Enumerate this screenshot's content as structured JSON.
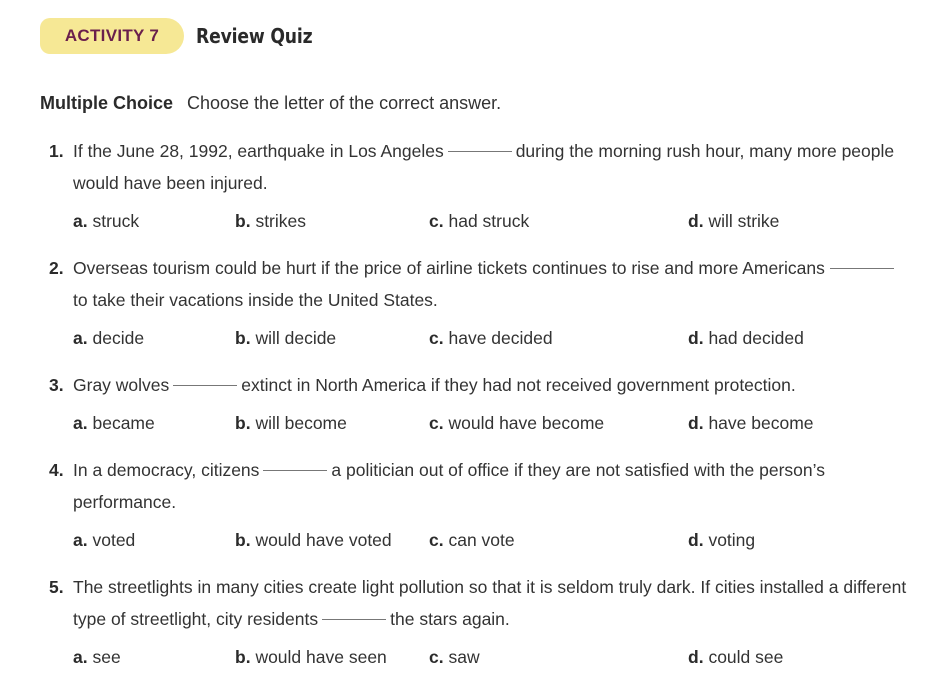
{
  "header": {
    "activity_label": "ACTIVITY 7",
    "title": "Review Quiz"
  },
  "instructions": {
    "heading": "Multiple Choice",
    "text": "Choose the letter of the correct answer."
  },
  "questions": [
    {
      "number": "1.",
      "text_before": "If the June 28, 1992, earthquake in Los Angeles",
      "text_after": "during the morning rush hour, many more people would have been injured.",
      "options": [
        {
          "letter": "a.",
          "text": "struck"
        },
        {
          "letter": "b.",
          "text": "strikes"
        },
        {
          "letter": "c.",
          "text": "had struck"
        },
        {
          "letter": "d.",
          "text": "will strike"
        }
      ]
    },
    {
      "number": "2.",
      "text_before": "Overseas tourism could be hurt if the price of airline tickets continues to rise and more Americans",
      "text_after": "to take their vacations inside the United States.",
      "options": [
        {
          "letter": "a.",
          "text": "decide"
        },
        {
          "letter": "b.",
          "text": "will decide"
        },
        {
          "letter": "c.",
          "text": "have decided"
        },
        {
          "letter": "d.",
          "text": "had decided"
        }
      ]
    },
    {
      "number": "3.",
      "text_before": "Gray wolves",
      "text_after": "extinct in North America if they had not received government protection.",
      "options": [
        {
          "letter": "a.",
          "text": "became"
        },
        {
          "letter": "b.",
          "text": "will become"
        },
        {
          "letter": "c.",
          "text": "would have become"
        },
        {
          "letter": "d.",
          "text": "have become"
        }
      ]
    },
    {
      "number": "4.",
      "text_before": "In a democracy, citizens",
      "text_after": "a politician out of office if they are not satisfied with the person’s performance.",
      "options": [
        {
          "letter": "a.",
          "text": "voted"
        },
        {
          "letter": "b.",
          "text": "would have voted"
        },
        {
          "letter": "c.",
          "text": "can vote"
        },
        {
          "letter": "d.",
          "text": "voting"
        }
      ]
    },
    {
      "number": "5.",
      "text_before": "The streetlights in many cities create light pollution so that it is seldom truly dark. If cities installed a different type of streetlight, city residents",
      "text_after": "the stars again.",
      "options": [
        {
          "letter": "a.",
          "text": "see"
        },
        {
          "letter": "b.",
          "text": "would have seen"
        },
        {
          "letter": "c.",
          "text": "saw"
        },
        {
          "letter": "d.",
          "text": "could see"
        }
      ]
    }
  ]
}
